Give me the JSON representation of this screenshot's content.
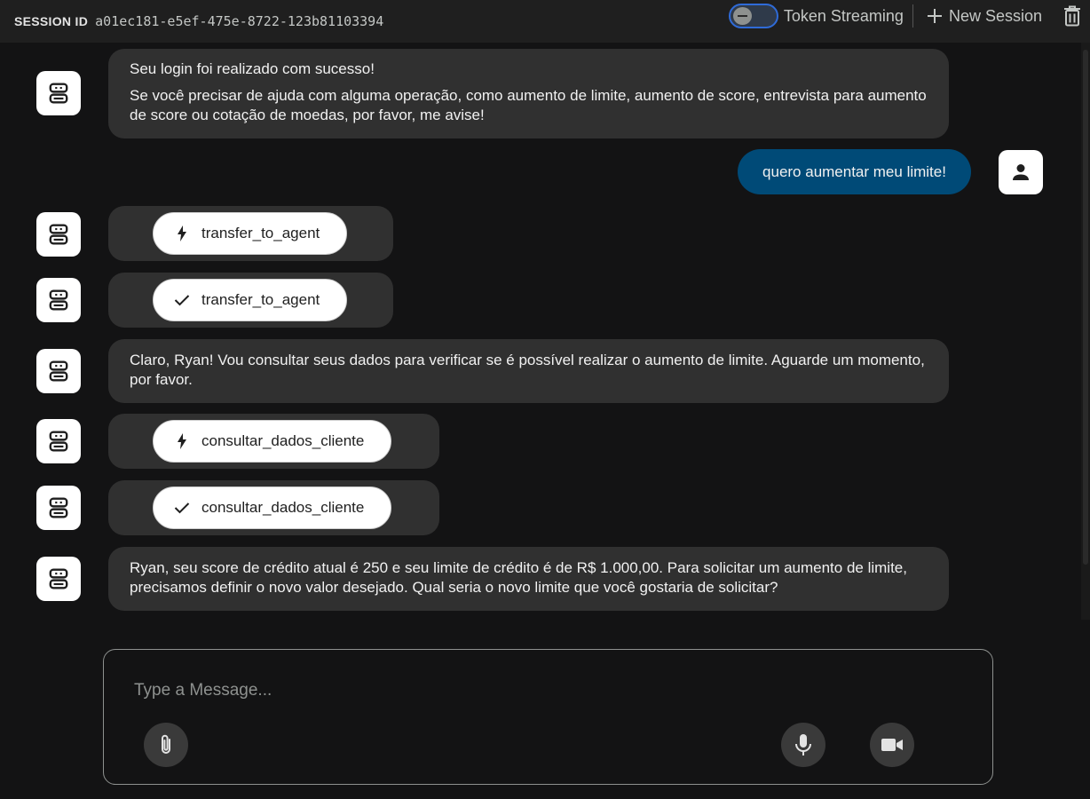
{
  "header": {
    "session_label": "SESSION ID",
    "session_id": "a01ec181-e5ef-475e-8722-123b81103394",
    "token_streaming_label": "Token Streaming",
    "token_streaming_enabled": false,
    "new_session_label": "New Session",
    "icons": [
      "toggle",
      "plus-icon",
      "trash-icon"
    ]
  },
  "messages": [
    {
      "role": "bot",
      "type": "text",
      "paragraphs": [
        "Seu login foi realizado com sucesso!",
        "Se você precisar de ajuda com alguma operação, como aumento de limite, aumento de score, entrevista para aumento de score ou cotação de moedas, por favor, me avise!"
      ]
    },
    {
      "role": "user",
      "type": "text",
      "text": "quero aumentar meu limite!"
    },
    {
      "role": "bot",
      "type": "function_call",
      "icon": "bolt-icon",
      "name": "transfer_to_agent"
    },
    {
      "role": "bot",
      "type": "function_response",
      "icon": "check-icon",
      "name": "transfer_to_agent"
    },
    {
      "role": "bot",
      "type": "text",
      "paragraphs": [
        "Claro, Ryan! Vou consultar seus dados para verificar se é possível realizar o aumento de limite. Aguarde um momento, por favor."
      ]
    },
    {
      "role": "bot",
      "type": "function_call",
      "icon": "bolt-icon",
      "name": "consultar_dados_cliente"
    },
    {
      "role": "bot",
      "type": "function_response",
      "icon": "check-icon",
      "name": "consultar_dados_cliente"
    },
    {
      "role": "bot",
      "type": "text",
      "paragraphs": [
        "Ryan, seu score de crédito atual é 250 e seu limite de crédito é de R$ 1.000,00. Para solicitar um aumento de limite, precisamos definir o novo valor desejado. Qual seria o novo limite que você gostaria de solicitar?"
      ]
    }
  ],
  "composer": {
    "placeholder": "Type a Message...",
    "value": "",
    "buttons": [
      "attach-icon",
      "microphone-icon",
      "video-camera-icon"
    ]
  },
  "colors": {
    "background": "#131314",
    "header": "#1f1f1f",
    "bot_bubble": "#303030",
    "user_bubble": "#004a77",
    "chip": "#ffffff",
    "toggle_border": "#2f6bd8"
  }
}
